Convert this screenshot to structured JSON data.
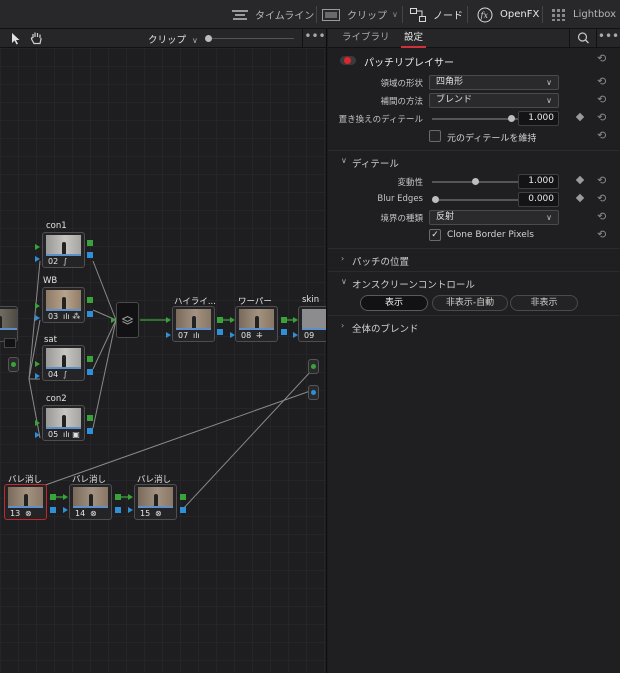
{
  "toolbar": {
    "timeline": "タイムライン",
    "clip": "クリップ",
    "nodes": "ノード",
    "openfx": "OpenFX",
    "lightbox": "Lightbox"
  },
  "node_panel": {
    "clip_label": "クリップ",
    "nodes": [
      {
        "id": "con1",
        "label": "con1",
        "num": "02",
        "icon": "∫"
      },
      {
        "id": "wb",
        "label": "WB",
        "num": "03",
        "icon": "ılı ⁂"
      },
      {
        "id": "sat",
        "label": "sat",
        "num": "04",
        "icon": "∫"
      },
      {
        "id": "con2",
        "label": "con2",
        "num": "05",
        "icon": "ılı ▣"
      },
      {
        "id": "highlight",
        "label": "ハイライ...",
        "num": "07",
        "icon": "ılı"
      },
      {
        "id": "warper",
        "label": "ワーパー",
        "num": "08",
        "icon": "⁜"
      },
      {
        "id": "skin",
        "label": "skin",
        "num": "09",
        "icon": ""
      },
      {
        "id": "blemish1",
        "label": "バレ消し",
        "num": "13",
        "icon": "⊗"
      },
      {
        "id": "blemish2",
        "label": "バレ消し",
        "num": "14",
        "icon": "⊗"
      },
      {
        "id": "blemish3",
        "label": "バレ消し",
        "num": "15",
        "icon": "⊗"
      }
    ]
  },
  "right_panel": {
    "tabs": [
      "ライブラリ",
      "設定"
    ],
    "active_tab": "設定",
    "plugin_title": "パッチリプレイサー",
    "region_shape": {
      "label": "領域の形状",
      "value": "四角形"
    },
    "interpolation": {
      "label": "補間の方法",
      "value": "ブレンド"
    },
    "replace_detail": {
      "label": "置き換えのディテール",
      "value": "1.000",
      "fraction": 0.96
    },
    "keep_detail": {
      "label": "元のディテールを維持",
      "checked": false
    },
    "detail_section": "ディテール",
    "variability": {
      "label": "変動性",
      "value": "1.000",
      "fraction": 0.5
    },
    "blur_edges": {
      "label": "Blur Edges",
      "value": "0.000",
      "fraction": 0.0
    },
    "boundary": {
      "label": "境界の種類",
      "value": "反射"
    },
    "clone_border": {
      "label": "Clone Border Pixels",
      "checked": true,
      "mark": "✓"
    },
    "patch_position": "パッチの位置",
    "onscreen_control": "オンスクリーンコントロール",
    "display_buttons": [
      "表示",
      "非表示-自動",
      "非表示"
    ],
    "global_blend": "全体のブレンド"
  }
}
